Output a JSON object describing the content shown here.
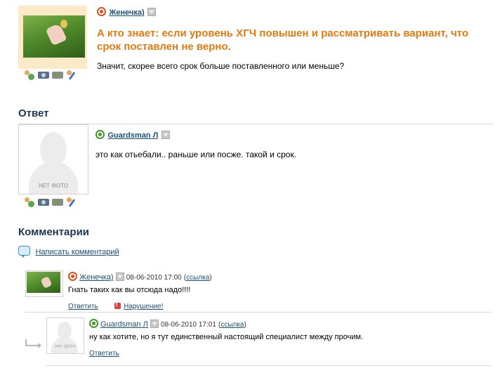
{
  "question": {
    "author": "Женечка)",
    "title": "А кто знает: если уровень ХГЧ повышен и рассматривать вариант, что срок поставлен не верно.",
    "body": "Значит, скорее всего срок больше поставленного или меньше?"
  },
  "answer_section": {
    "heading": "Ответ",
    "author": "Guardsman Л",
    "nophoto_label": "НЕТ ФОТО",
    "text": "это как отьебали.. раньше или посже. такой и срок."
  },
  "comments_section": {
    "heading": "Комментарии",
    "write_comment": "Написать комментарий",
    "comments": [
      {
        "author": "Женечка)",
        "date": "08-06-2010 17:00",
        "link_open": "(",
        "link_label": "ссылка",
        "link_close": ")",
        "text": "Гнать таких как вы отсюда надо!!!!",
        "reply": "Ответить",
        "report": "Нарушение!"
      },
      {
        "author": "Guardsman Л",
        "date": "08-06-2010 17:01",
        "link_open": "(",
        "link_label": "ссылка",
        "link_close": ")",
        "nophoto_label": "нет фото",
        "text": "ну как хотите, но я тут единственный настоящий специалист между прочим.",
        "reply": "Ответить"
      }
    ]
  },
  "icons": [
    "friends-icon",
    "camera-icon",
    "video-icon",
    "blog-icon",
    "mail-icon",
    "dropdown-icon",
    "comment-icon",
    "violation-icon"
  ],
  "colors": {
    "title_orange": "#e07a10",
    "link_blue": "#1a4f7a",
    "heading_dark": "#1b3750"
  }
}
